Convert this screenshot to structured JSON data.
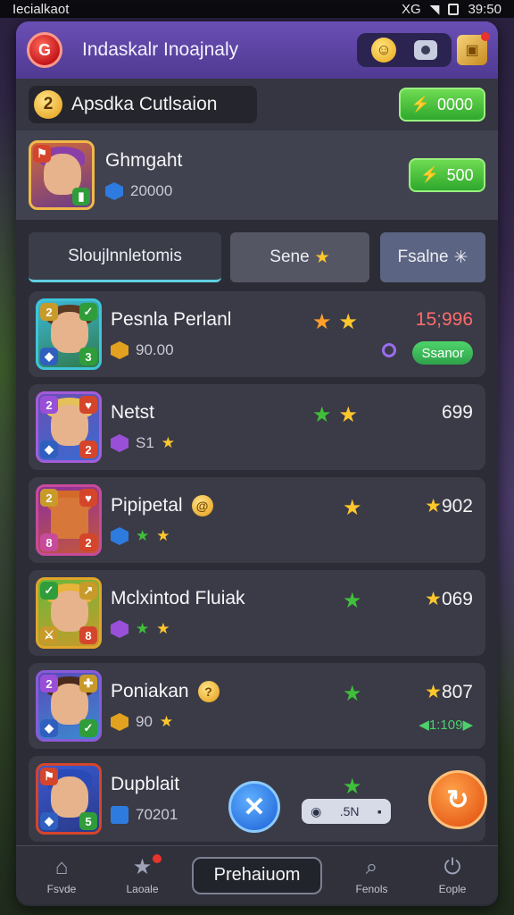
{
  "status_bar": {
    "carrier": "Iecialkaot",
    "network": "XG",
    "time": "39:50"
  },
  "header": {
    "title": "Indaskalr Inoajnaly"
  },
  "guild": {
    "level": "2",
    "name": "Apsdka Cutlsaion",
    "currency_value": "0000"
  },
  "player": {
    "name": "Ghmgaht",
    "gems": "20000",
    "button_value": "500"
  },
  "tabs": [
    {
      "label": "Sloujlnnletomis"
    },
    {
      "label": "Sene"
    },
    {
      "label": "Fsalne"
    }
  ],
  "entries": [
    {
      "name": "Pesnla Perlanl",
      "sub_value": "90.00",
      "score": "15;996",
      "status": "Ssanor"
    },
    {
      "name": "Netst",
      "sub_value": "S1",
      "score": "699"
    },
    {
      "name": "Pipipetal",
      "sub_value": "",
      "score": "902"
    },
    {
      "name": "Mclxintod Fluiak",
      "sub_value": "",
      "score": "069"
    },
    {
      "name": "Poniakan",
      "sub_value": "90",
      "score": "807",
      "trend": "1:109"
    },
    {
      "name": "Dupblait",
      "sub_value": "70201",
      "score": ""
    }
  ],
  "overlay": {
    "toggle_label": ".5N"
  },
  "bottom_nav": {
    "home": "Fsvde",
    "second": "Laoale",
    "premium": "Prehaiuom",
    "search": "Fenols",
    "profile": "Eople"
  },
  "colors": {
    "header": "#5a43a2",
    "accent_green": "#3fbf3a",
    "accent_gold": "#ffc72c",
    "tab_underline": "#5fd0e0"
  }
}
